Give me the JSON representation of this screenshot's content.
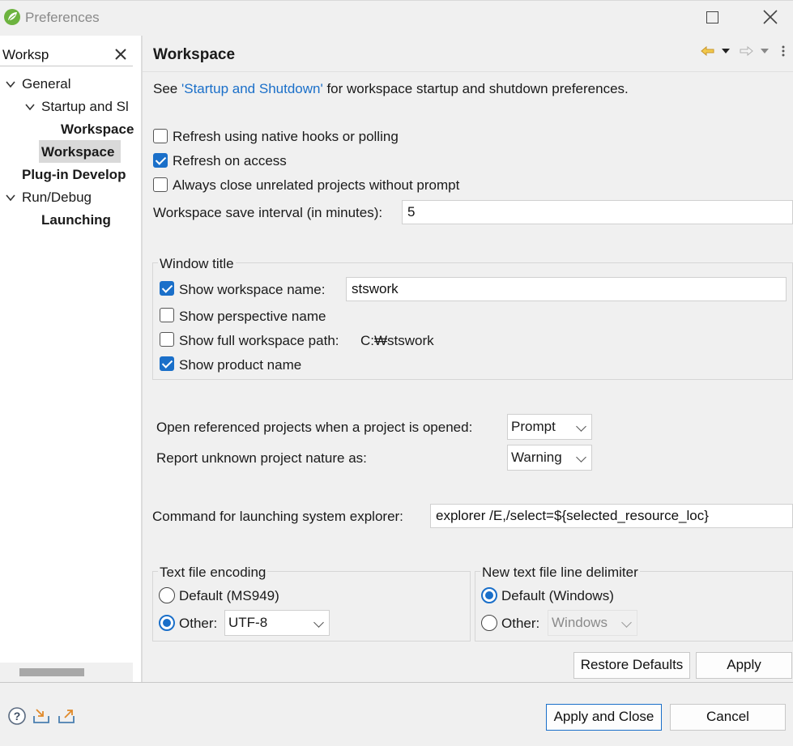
{
  "window": {
    "title": "Preferences"
  },
  "filter": {
    "value": "Worksp"
  },
  "tree": {
    "general": "General",
    "startup_and_shutdown": "Startup and Sl",
    "workspaces": "Workspace",
    "workspace": "Workspace",
    "plugin_development": "Plug-in Develop",
    "run_debug": "Run/Debug",
    "launching": "Launching"
  },
  "page": {
    "title": "Workspace",
    "desc_prefix": "See ",
    "desc_link": "'Startup and Shutdown'",
    "desc_suffix": " for workspace startup and shutdown preferences."
  },
  "options": {
    "refresh_native": {
      "label": "Refresh using native hooks or polling",
      "checked": false
    },
    "refresh_access": {
      "label": "Refresh on access",
      "checked": true
    },
    "always_close": {
      "label": "Always close unrelated projects without prompt",
      "checked": false
    },
    "save_interval_label": "Workspace save interval (in minutes):",
    "save_interval_value": "5"
  },
  "window_title_group": {
    "title": "Window title",
    "show_workspace_name": {
      "label": "Show workspace name:",
      "checked": true,
      "value": "stswork"
    },
    "show_perspective_name": {
      "label": "Show perspective name",
      "checked": false
    },
    "show_full_path": {
      "label": "Show full workspace path:",
      "checked": false,
      "path": "C:₩stswork"
    },
    "show_product_name": {
      "label": "Show product name",
      "checked": true
    }
  },
  "projects": {
    "open_referenced_label": "Open referenced projects when a project is opened:",
    "open_referenced_value": "Prompt",
    "report_unknown_label": "Report unknown project nature as:",
    "report_unknown_value": "Warning"
  },
  "explorer": {
    "label": "Command for launching system explorer:",
    "value": "explorer /E,/select=${selected_resource_loc}"
  },
  "encoding_group": {
    "title": "Text file encoding",
    "default_label": "Default (MS949)",
    "other_label": "Other:",
    "other_value": "UTF-8",
    "selected": "other"
  },
  "delimiter_group": {
    "title": "New text file line delimiter",
    "default_label": "Default (Windows)",
    "other_label": "Other:",
    "other_value": "Windows",
    "selected": "default"
  },
  "buttons": {
    "restore_defaults": "Restore Defaults",
    "apply": "Apply",
    "apply_and_close": "Apply and Close",
    "cancel": "Cancel"
  },
  "icons": {
    "app": "spring-leaf-icon",
    "help": "help-icon",
    "import": "import-icon",
    "export": "export-icon"
  },
  "colors": {
    "accent": "#1a6fc9",
    "app_logo": "#6db33f"
  }
}
